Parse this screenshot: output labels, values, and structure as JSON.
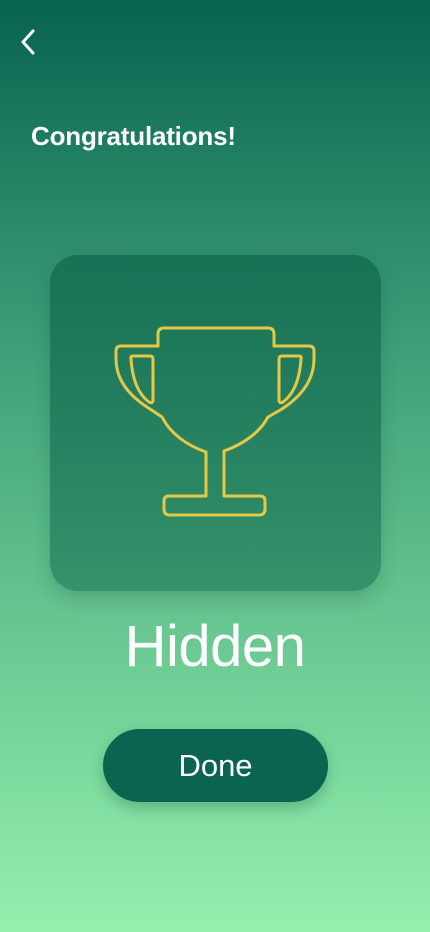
{
  "header": {
    "back_icon": "chevron-left-icon",
    "title": "Congratulations!"
  },
  "badge": {
    "icon": "trophy-icon",
    "icon_color": "#e5c846",
    "name": "Hidden"
  },
  "actions": {
    "done_label": "Done"
  },
  "colors": {
    "background_top": "#08634f",
    "background_bottom": "#94f0ae",
    "button": "#0a6450",
    "text": "#ffffff"
  }
}
